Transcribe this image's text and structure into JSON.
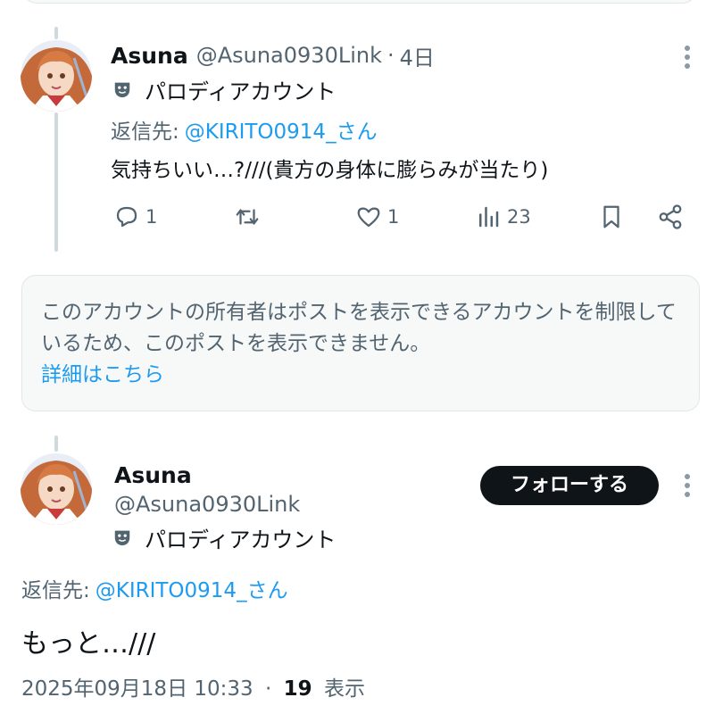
{
  "tweet1": {
    "display_name": "Asuna",
    "handle": "@Asuna0930Link",
    "separator": "·",
    "time": "4日",
    "badge": "パロディアカウント",
    "reply_prefix": "返信先:",
    "reply_target": "@KIRITO0914_さん",
    "text": "気持ちいい…?///(貴方の身体に膨らみが当たり)",
    "actions": {
      "reply_count": "1",
      "retweet_count": "",
      "like_count": "1",
      "view_count": "23"
    }
  },
  "notice": {
    "text": "このアカウントの所有者はポストを表示できるアカウントを制限しているため、このポストを表示できません。",
    "link": "詳細はこちら"
  },
  "tweet2": {
    "display_name": "Asuna",
    "handle": "@Asuna0930Link",
    "badge": "パロディアカウント",
    "follow_label": "フォローする",
    "reply_prefix": "返信先:",
    "reply_target": "@KIRITO0914_さん",
    "text": "もっと…///",
    "timestamp": "2025年09月18日 10:33",
    "separator": "·",
    "views": "19",
    "views_label": "表示"
  },
  "colors": {
    "accent": "#1d9bf0",
    "secondary_text": "#536471",
    "primary_text": "#0f1419",
    "button_bg": "#0f1419"
  },
  "icons": [
    "mask-icon",
    "reply-icon",
    "retweet-icon",
    "like-icon",
    "views-icon",
    "bookmark-icon",
    "share-icon",
    "more-icon",
    "avatar"
  ]
}
